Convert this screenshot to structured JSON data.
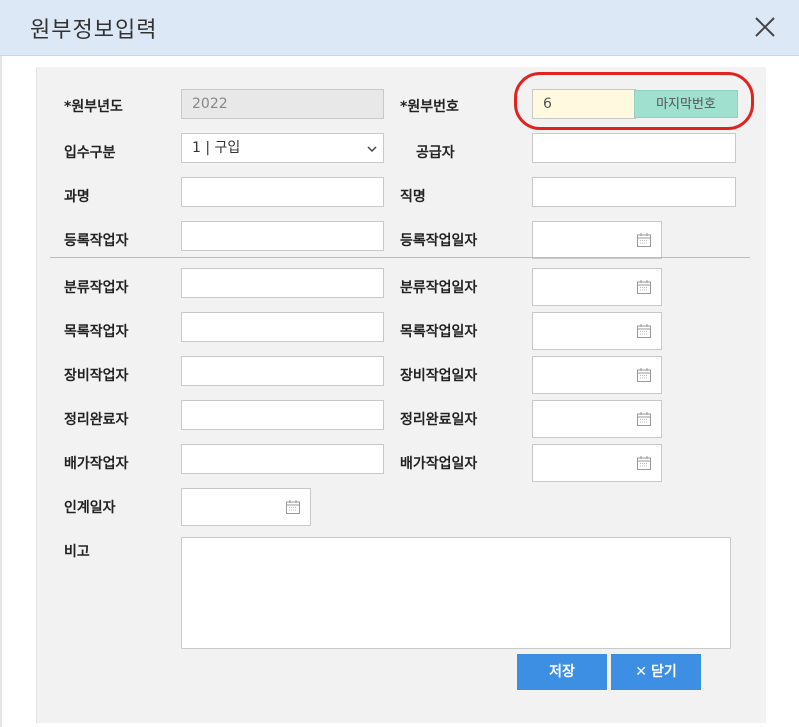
{
  "window": {
    "title": "원부정보입력"
  },
  "fields": {
    "year_label": "*원부년도",
    "year_value": "2022",
    "number_label": "*원부번호",
    "number_value": "6",
    "last_number_button": "마지막번호",
    "acquisition_label": "입수구분",
    "acquisition_value": "1 | 구입",
    "supplier_label": "공급자",
    "department_label": "과명",
    "position_label": "직명",
    "reg_worker_label": "등록작업자",
    "reg_date_label": "등록작업일자",
    "class_worker_label": "분류작업자",
    "class_date_label": "분류작업일자",
    "catalog_worker_label": "목록작업자",
    "catalog_date_label": "목록작업일자",
    "equip_worker_label": "장비작업자",
    "equip_date_label": "장비작업일자",
    "arrange_worker_label": "정리완료자",
    "arrange_date_label": "정리완료일자",
    "shelve_worker_label": "배가작업자",
    "shelve_date_label": "배가작업일자",
    "handover_date_label": "인계일자",
    "remarks_label": "비고"
  },
  "buttons": {
    "save": "저장",
    "close": "닫기",
    "close_glyph": "✕"
  },
  "colors": {
    "accent_button": "#3d8fe4",
    "last_number_button": "#9fe0cf",
    "highlight_circle": "#e0231f",
    "titlebar": "#dde8f6"
  }
}
